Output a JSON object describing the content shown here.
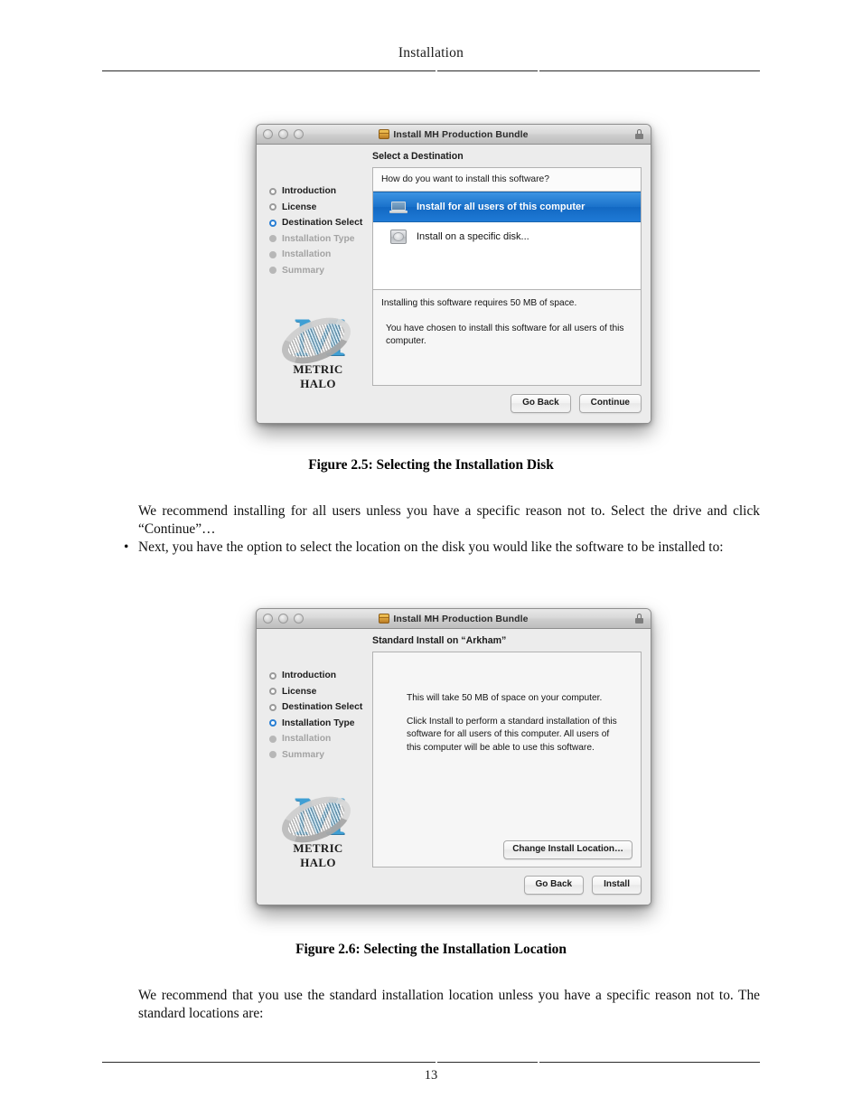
{
  "page": {
    "header_title": "Installation",
    "page_number": "13"
  },
  "body": {
    "para1": "We recommend installing for all users unless you have a specific reason not to. Select the drive and click “Continue”…",
    "bullet1_marker": "•",
    "bullet1": "Next, you have the option to select the location on the disk you would like the software to be installed to:",
    "para2": "We recommend that you use the standard installation location unless you have a specific reason not to. The standard locations are:"
  },
  "figures": {
    "caption1": "Figure 2.5: Selecting the Installation Disk",
    "caption2": "Figure 2.6: Selecting the Installation Location"
  },
  "installer1": {
    "window_title": "Install MH Production Bundle",
    "pane_title": "Select a Destination",
    "question": "How do you want to install this software?",
    "options": [
      {
        "label": "Install for all users of this computer",
        "icon": "laptop-icon",
        "selected": true
      },
      {
        "label": "Install on a specific disk...",
        "icon": "hard-disk-icon",
        "selected": false
      }
    ],
    "info_line1": "Installing this software requires 50 MB of space.",
    "info_line2": "You have chosen to install this software for all users of this computer.",
    "steps": [
      {
        "label": "Introduction",
        "state": "done"
      },
      {
        "label": "License",
        "state": "done"
      },
      {
        "label": "Destination Select",
        "state": "current"
      },
      {
        "label": "Installation Type",
        "state": "future"
      },
      {
        "label": "Installation",
        "state": "future"
      },
      {
        "label": "Summary",
        "state": "future"
      }
    ],
    "logo": {
      "letter": "M",
      "brand": "METRIC HALO"
    },
    "buttons": {
      "back": "Go Back",
      "primary": "Continue"
    }
  },
  "installer2": {
    "window_title": "Install MH Production Bundle",
    "pane_title": "Standard Install on “Arkham”",
    "info_line1": "This will take 50 MB of space on your computer.",
    "info_line2": "Click Install to perform a standard installation of this software for all users of this computer. All users of this computer will be able to use this software.",
    "steps": [
      {
        "label": "Introduction",
        "state": "done"
      },
      {
        "label": "License",
        "state": "done"
      },
      {
        "label": "Destination Select",
        "state": "done"
      },
      {
        "label": "Installation Type",
        "state": "current"
      },
      {
        "label": "Installation",
        "state": "future"
      },
      {
        "label": "Summary",
        "state": "future"
      }
    ],
    "logo": {
      "letter": "M",
      "brand": "METRIC HALO"
    },
    "buttons": {
      "change_location": "Change Install Location…",
      "back": "Go Back",
      "primary": "Install"
    }
  },
  "colors": {
    "selection_blue": "#1a72cb",
    "logo_blue": "#3f9fd4",
    "step_current": "#2a7fd4"
  }
}
